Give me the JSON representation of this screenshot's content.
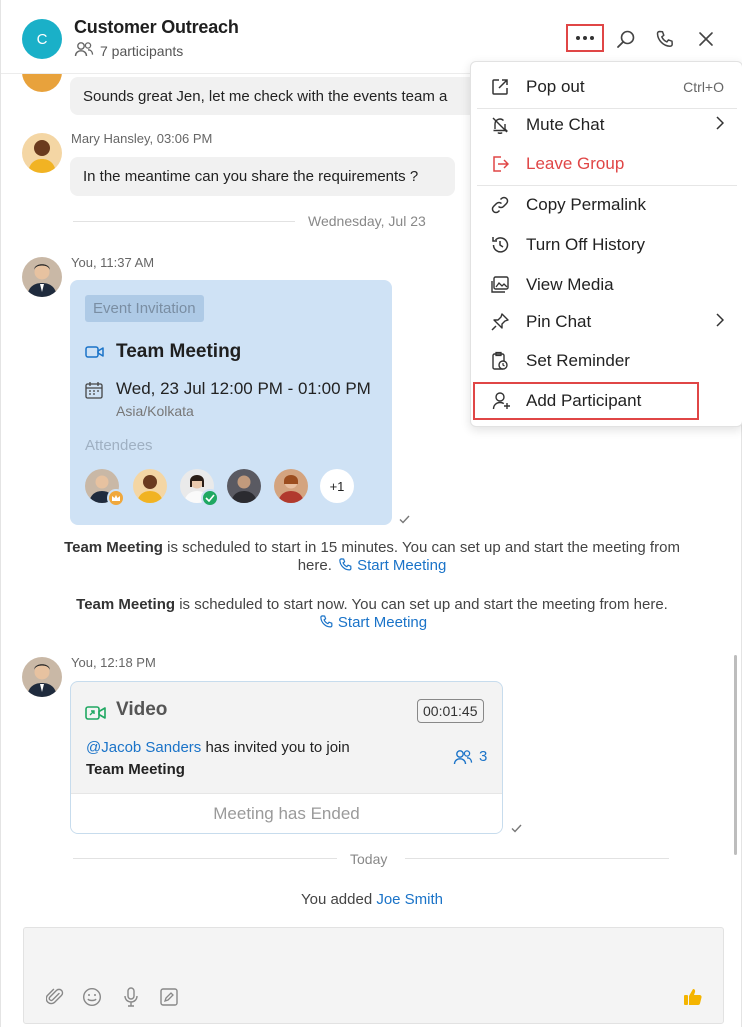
{
  "header": {
    "avatar_letter": "C",
    "title": "Customer Outreach",
    "participants": "7 participants"
  },
  "messages": {
    "m1_text": "Sounds great Jen, let me check with the events team a",
    "m2_sender": "Mary Hansley, 03:06 PM",
    "m2_text": "In the meantime can you share the requirements ?",
    "day1": "Wednesday, Jul 23",
    "m3_sender": "You, 11:37 AM",
    "m4_sender": "You, 12:18 PM",
    "day2": "Today"
  },
  "event": {
    "badge": "Event Invitation",
    "title": "Team Meeting",
    "datetime": "Wed, 23 Jul 12:00 PM - 01:00 PM",
    "timezone": "Asia/Kolkata",
    "attendees_label": "Attendees",
    "more_count": "+1"
  },
  "system": {
    "s1_bold": "Team Meeting",
    "s1_text": " is scheduled to start in 15 minutes. You can set up and start the meeting from",
    "s1_text2": "here.",
    "s1_link": "Start Meeting",
    "s2_bold": "Team Meeting",
    "s2_text": " is scheduled to start now. You can set up and start the meeting from here.",
    "s2_link": "Start Meeting",
    "added_text": "You added ",
    "added_name": "Joe Smith"
  },
  "video": {
    "title": "Video",
    "duration": "00:01:45",
    "mention": "@Jacob Sanders",
    "invite_text": " has invited you to join",
    "meeting_name": "Team Meeting",
    "participant_count": "3",
    "footer": "Meeting has Ended"
  },
  "menu": {
    "items": [
      {
        "label": "Pop out",
        "shortcut": "Ctrl+O"
      },
      {
        "label": "Mute Chat"
      },
      {
        "label": "Leave Group"
      },
      {
        "label": "Copy Permalink"
      },
      {
        "label": "Turn Off History"
      },
      {
        "label": "View Media"
      },
      {
        "label": "Pin Chat"
      },
      {
        "label": "Set Reminder"
      },
      {
        "label": "Add Participant"
      }
    ]
  },
  "colors": {
    "accent": "#1a73c8",
    "avatar": "#1ab0c8",
    "danger": "#e04646",
    "event_card": "#cfe2f5"
  }
}
